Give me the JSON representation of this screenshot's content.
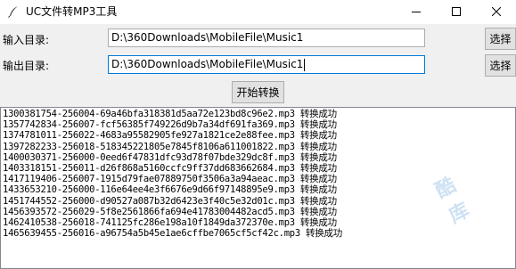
{
  "window": {
    "title": "UC文件转MP3工具",
    "icons": {
      "app": "feather-icon",
      "minimize": "minimize-icon",
      "maximize": "maximize-icon",
      "close": "close-icon"
    }
  },
  "input_row": {
    "label": "输入目录:",
    "value": "D:\\360Downloads\\MobileFile\\Music1",
    "button": "选择"
  },
  "output_row": {
    "label": "输出目录:",
    "value": "D:\\360Downloads\\MobileFile\\Music1",
    "button": "选择"
  },
  "start_button": "开始转换",
  "log": [
    "1300381754-256004-69a46bfa318381d5aa72e123bd8c96e2.mp3 转换成功",
    "1357742834-256007-fcf56385f749226d9b7a34df691fa369.mp3 转换成功",
    "1374781011-256022-4683a95582905fe927a1821ce2e88fee.mp3 转换成功",
    "1397282233-256018-518345221805e7845f8106a611001822.mp3 转换成功",
    "1400030371-256000-0eed6f47831dfc93d78f07bde329dc8f.mp3 转换成功",
    "1403318151-256011-d26f868a5160ccfc9ff37dd683662684.mp3 转换成功",
    "1417119406-256007-1915d79fae07889750f3506a3a94aeac.mp3 转换成功",
    "1433653210-256000-116e64ee4e3f6676e9d66f97148895e9.mp3 转换成功",
    "1451744552-256000-d90527a087b32d6423e3f40c5e32d01c.mp3 转换成功",
    "1456393572-256029-5f8e2561866fa694e41783004482acd5.mp3 转换成功",
    "1462410538-256018-741125fc286e198a10f1849da372370e.mp3 转换成功",
    "1465639455-256016-a96754a5b45e1ae6cffbe7065cf5cf42c.mp3 转换成功"
  ],
  "watermark": [
    "酷",
    "库"
  ],
  "colors": {
    "focus_border": "#0078d7",
    "client_bg": "#f0f0f0",
    "button_bg": "#e1e1e1"
  }
}
